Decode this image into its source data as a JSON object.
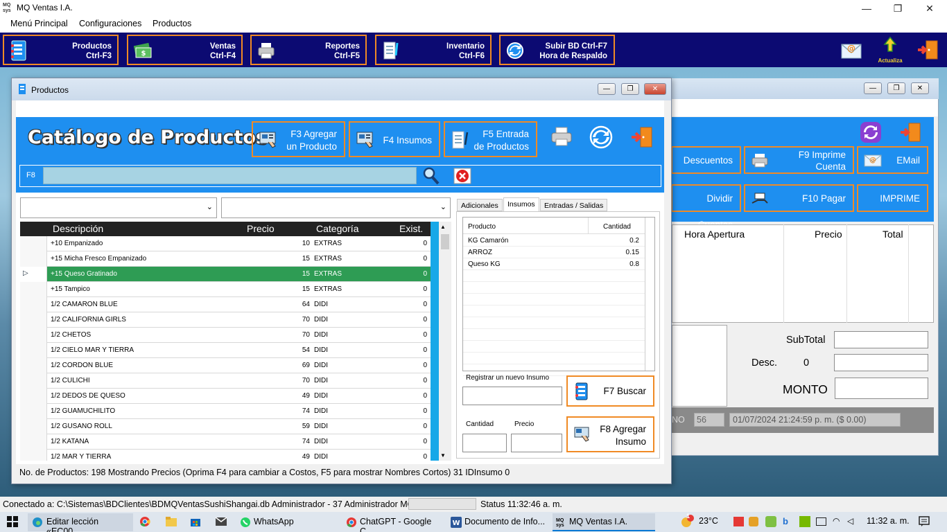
{
  "app": {
    "title": "MQ Ventas I.A.",
    "icon_text": "MQ\nsys"
  },
  "window_controls": {
    "minimize": "—",
    "restore": "❐",
    "close": "✕"
  },
  "menu": [
    "Menú Principal",
    "Configuraciones",
    "Productos"
  ],
  "toolbar": [
    {
      "label1": "Productos",
      "label2": "Ctrl-F3"
    },
    {
      "label1": "Ventas",
      "label2": "Ctrl-F4"
    },
    {
      "label1": "Reportes",
      "label2": "Ctrl-F5"
    },
    {
      "label1": "Inventario",
      "label2": "Ctrl-F6"
    },
    {
      "label1": "Subir BD   Ctrl-F7",
      "label2": "Hora de Respaldo"
    }
  ],
  "toolbar_right": {
    "actualiza": "Actualiza"
  },
  "ventas_window": {
    "buttons": {
      "descuentos": "Descuentos",
      "imprime_cuenta1": "F9 Imprime",
      "imprime_cuenta2": "Cuenta",
      "email": "EMail",
      "dividir": "Dividir Cuentas",
      "pagar": "F10 Pagar",
      "imprime": "IMPRIME"
    },
    "columns": [
      "Hora Apertura",
      "Precio",
      "Total"
    ],
    "subtotal_label": "SubTotal",
    "desc_label": "Desc.",
    "desc_value": "0",
    "monto_label": "MONTO",
    "footer_partial_label": "NO",
    "footer_number": "56",
    "footer_date": "01/07/2024 21:24:59 p. m. ($ 0.00)"
  },
  "productos_window": {
    "title": "Productos",
    "catalog_title": "Catálogo de Productos",
    "btn_agregar1": "F3 Agregar",
    "btn_agregar2": "un Producto",
    "btn_insumos": "F4 Insumos",
    "btn_entrada1": "F5 Entrada",
    "btn_entrada2": "de Productos",
    "search_key": "F8",
    "search_value": "",
    "grid_columns": [
      "Descripción",
      "Precio",
      "Categoría",
      "Exist."
    ],
    "rows": [
      {
        "desc": "+10 Empanizado",
        "precio": "10",
        "cat": "EXTRAS",
        "exist": "0"
      },
      {
        "desc": "+15 Micha Fresco Empanizado",
        "precio": "15",
        "cat": "EXTRAS",
        "exist": "0"
      },
      {
        "desc": "+15 Queso Gratinado",
        "precio": "15",
        "cat": "EXTRAS",
        "exist": "0"
      },
      {
        "desc": "+15 Tampico",
        "precio": "15",
        "cat": "EXTRAS",
        "exist": "0"
      },
      {
        "desc": "1/2 CAMARON BLUE",
        "precio": "64",
        "cat": "DIDI",
        "exist": "0"
      },
      {
        "desc": "1/2 CALIFORNIA GIRLS",
        "precio": "70",
        "cat": "DIDI",
        "exist": "0"
      },
      {
        "desc": "1/2 CHETOS",
        "precio": "70",
        "cat": "DIDI",
        "exist": "0"
      },
      {
        "desc": "1/2 CIELO MAR Y TIERRA",
        "precio": "54",
        "cat": "DIDI",
        "exist": "0"
      },
      {
        "desc": "1/2 CORDON BLUE",
        "precio": "69",
        "cat": "DIDI",
        "exist": "0"
      },
      {
        "desc": "1/2 CULICHI",
        "precio": "70",
        "cat": "DIDI",
        "exist": "0"
      },
      {
        "desc": "1/2 DEDOS DE QUESO",
        "precio": "49",
        "cat": "DIDI",
        "exist": "0"
      },
      {
        "desc": "1/2 GUAMUCHILITO",
        "precio": "74",
        "cat": "DIDI",
        "exist": "0"
      },
      {
        "desc": "1/2 GUSANO ROLL",
        "precio": "59",
        "cat": "DIDI",
        "exist": "0"
      },
      {
        "desc": "1/2 KATANA",
        "precio": "74",
        "cat": "DIDI",
        "exist": "0"
      },
      {
        "desc": "1/2 MAR Y TIERRA",
        "precio": "49",
        "cat": "DIDI",
        "exist": "0"
      }
    ],
    "tabs": [
      "Adicionales",
      "Insumos",
      "Entradas / Salidas"
    ],
    "insumos_columns": [
      "Producto",
      "Cantidad"
    ],
    "insumos": [
      {
        "producto": "KG Camarón",
        "cantidad": "0.2"
      },
      {
        "producto": "ARROZ",
        "cantidad": "0.15"
      },
      {
        "producto": "Queso KG",
        "cantidad": "0.8"
      }
    ],
    "registrar_label": "Registrar un nuevo Insumo",
    "btn_buscar": "F7 Buscar",
    "cantidad_label": "Cantidad",
    "precio_label": "Precio",
    "btn_agregar_insumo1": "F8 Agregar",
    "btn_agregar_insumo2": "Insumo",
    "status": "No. de Productos: 198  Mostrando Precios (Oprima F4 para cambiar a Costos, F5 para mostrar Nombres Cortos)  31  IDInsumo  0"
  },
  "bottom": {
    "connection": "Conectado a: C:\\Sistemas\\BDClientes\\BDMQVentasSushiShangai.db  Administrador   - 37  Administrador  MQ",
    "status": "Status  11:32:46 a. m."
  },
  "taskbar": {
    "items": [
      "Editar lección «EC00...",
      "WhatsApp",
      "ChatGPT - Google C...",
      "Documento de Info...",
      "MQ Ventas I.A."
    ],
    "temp": "23°C",
    "clock": "11:32 a. m.",
    "notif_count": "1"
  },
  "colors": {
    "toolbar": "#0c0a72",
    "accent_orange": "#f08a24",
    "panel_blue": "#1e8ff0",
    "selected_row": "#2e9c54"
  }
}
